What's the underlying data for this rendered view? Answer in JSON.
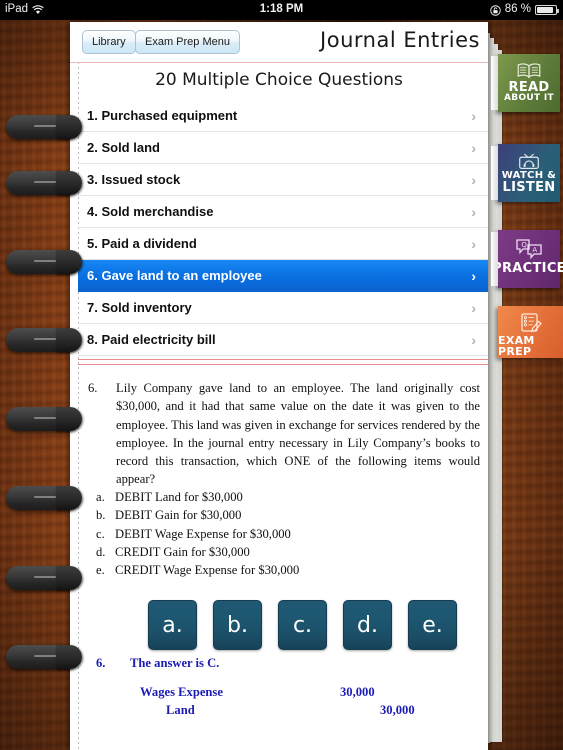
{
  "status_bar": {
    "device": "iPad",
    "wifi_icon": "wifi-icon",
    "time": "1:18 PM",
    "rotation_lock_icon": "rotation-lock-icon",
    "battery_percent": "86 %",
    "battery_icon": "battery-icon"
  },
  "header": {
    "library_button": "Library",
    "exam_prep_menu_button": "Exam Prep Menu",
    "title": "Journal Entries"
  },
  "list": {
    "title": "20 Multiple Choice Questions",
    "chevron": "›",
    "items": [
      {
        "label": "1. Purchased equipment",
        "selected": false
      },
      {
        "label": "2. Sold land",
        "selected": false
      },
      {
        "label": "3. Issued stock",
        "selected": false
      },
      {
        "label": "4. Sold merchandise",
        "selected": false
      },
      {
        "label": "5. Paid a dividend",
        "selected": false
      },
      {
        "label": "6. Gave land to an employee",
        "selected": true
      },
      {
        "label": "7. Sold inventory",
        "selected": false
      },
      {
        "label": "8. Paid electricity bill",
        "selected": false
      }
    ]
  },
  "question": {
    "number": "6.",
    "text": "Lily Company gave land to an employee. The land originally cost $30,000, and it had that same value on the date it was given to the employee. This land was given in exchange for services rendered by the employee. In the journal entry necessary in Lily Company’s books to record this transaction, which ONE of the following items would appear?",
    "choices": [
      {
        "label": "a.",
        "text": "DEBIT Land for $30,000"
      },
      {
        "label": "b.",
        "text": "DEBIT Gain for $30,000"
      },
      {
        "label": "c.",
        "text": "DEBIT Wage Expense for $30,000"
      },
      {
        "label": "d.",
        "text": "CREDIT Gain for $30,000"
      },
      {
        "label": "e.",
        "text": "CREDIT Wage Expense for $30,000"
      }
    ]
  },
  "answer_buttons": [
    "a.",
    "b.",
    "c.",
    "d.",
    "e."
  ],
  "answer_key": {
    "number": "6.",
    "statement": "The answer is C.",
    "journal_entry": [
      {
        "account": "Wages Expense",
        "indent": false,
        "amount": "30,000",
        "side": "debit"
      },
      {
        "account": "Land",
        "indent": true,
        "amount": "30,000",
        "side": "credit"
      }
    ]
  },
  "rail_tabs": [
    {
      "id": "read",
      "line1": "READ",
      "line2": "ABOUT IT",
      "icon": "open-book-icon",
      "color": "#5f7c3a"
    },
    {
      "id": "watch",
      "line1": "WATCH &",
      "line2": "LISTEN",
      "icon": "tv-headphones-icon",
      "color": "#2b5f78"
    },
    {
      "id": "practice",
      "line1": "PRACTICE",
      "line2": "",
      "icon": "qa-speech-bubbles-icon",
      "color": "#6d2f78"
    },
    {
      "id": "exam",
      "line1": "EXAM PREP",
      "line2": "",
      "icon": "checklist-pencil-icon",
      "color": "#e4703a"
    }
  ]
}
